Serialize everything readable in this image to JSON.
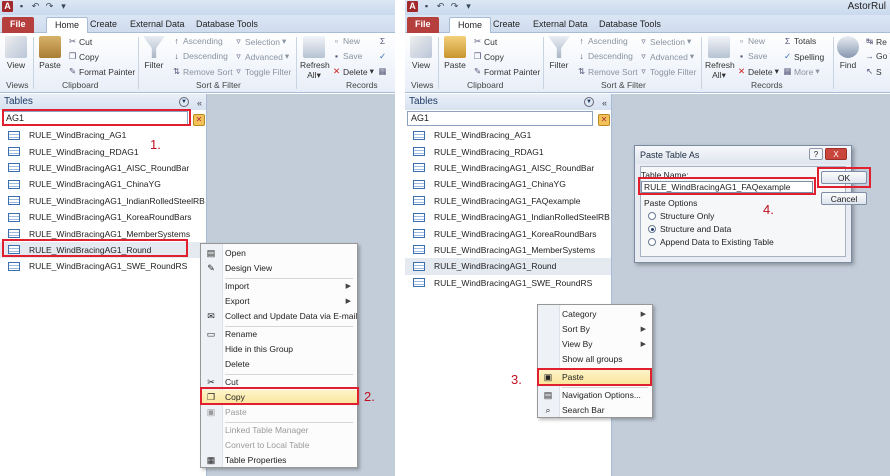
{
  "left": {
    "tabs": {
      "file": "File",
      "home": "Home",
      "create": "Create",
      "external": "External Data",
      "dbtools": "Database Tools"
    },
    "ribbon": {
      "view": "View",
      "paste": "Paste",
      "cut": "Cut",
      "copy": "Copy",
      "format_painter": "Format Painter",
      "filter": "Filter",
      "ascending": "Ascending",
      "descending": "Descending",
      "remove_sort": "Remove Sort",
      "selection": "Selection",
      "advanced": "Advanced",
      "toggle_filter": "Toggle Filter",
      "refresh": "Refresh",
      "refresh2": "All",
      "new": "New",
      "save": "Save",
      "delete": "Delete",
      "views_group": "Views",
      "clipboard_group": "Clipboard",
      "sortfilter_group": "Sort & Filter",
      "records_group": "Records"
    },
    "nav": {
      "title": "Tables",
      "search_value": "AG1",
      "items": [
        "RULE_WindBracing_AG1",
        "RULE_WindBracing_RDAG1",
        "RULE_WindBracingAG1_AISC_RoundBar",
        "RULE_WindBracingAG1_ChinaYG",
        "RULE_WindBracingAG1_IndianRolledSteelRB",
        "RULE_WindBracingAG1_KoreaRoundBars",
        "RULE_WindBracingAG1_MemberSystems",
        "RULE_WindBracingAG1_Round",
        "RULE_WindBracingAG1_SWE_RoundRS"
      ]
    },
    "context_menu": [
      "Open",
      "Design View",
      "Import",
      "Export",
      "Collect and Update Data via E-mail",
      "Rename",
      "Hide in this Group",
      "Delete",
      "Cut",
      "Copy",
      "Paste",
      "Linked Table Manager",
      "Convert to Local Table",
      "Table Properties"
    ],
    "steps": {
      "s1": "1.",
      "s2": "2."
    }
  },
  "right": {
    "window_title": "AstorRul",
    "tabs": {
      "file": "File",
      "home": "Home",
      "create": "Create",
      "external": "External Data",
      "dbtools": "Database Tools"
    },
    "ribbon": {
      "view": "View",
      "paste": "Paste",
      "cut": "Cut",
      "copy": "Copy",
      "format_painter": "Format Painter",
      "filter": "Filter",
      "ascending": "Ascending",
      "descending": "Descending",
      "remove_sort": "Remove Sort",
      "selection": "Selection",
      "advanced": "Advanced",
      "toggle_filter": "Toggle Filter",
      "refresh": "Refresh",
      "refresh2": "All",
      "new": "New",
      "save": "Save",
      "delete": "Delete",
      "totals": "Totals",
      "spelling": "Spelling",
      "more": "More",
      "find": "Find",
      "replace": "Re",
      "goto": "Go T",
      "select": "S",
      "views_group": "Views",
      "clipboard_group": "Clipboard",
      "sortfilter_group": "Sort & Filter",
      "records_group": "Records"
    },
    "nav": {
      "title": "Tables",
      "search_value": "AG1",
      "items": [
        "RULE_WindBracing_AG1",
        "RULE_WindBracing_RDAG1",
        "RULE_WindBracingAG1_AISC_RoundBar",
        "RULE_WindBracingAG1_ChinaYG",
        "RULE_WindBracingAG1_FAQexample",
        "RULE_WindBracingAG1_IndianRolledSteelRB",
        "RULE_WindBracingAG1_KoreaRoundBars",
        "RULE_WindBracingAG1_MemberSystems",
        "RULE_WindBracingAG1_Round",
        "RULE_WindBracingAG1_SWE_RoundRS"
      ]
    },
    "context_menu": [
      "Category",
      "Sort By",
      "View By",
      "Show all groups",
      "Paste",
      "Navigation Options...",
      "Search Bar"
    ],
    "dialog": {
      "title": "Paste Table As",
      "help": "?",
      "close": "X",
      "table_name_label": "Table Name:",
      "table_name_value": "RULE_WindBracingAG1_FAQexample",
      "paste_options_label": "Paste Options",
      "opt1": "Structure Only",
      "opt2": "Structure and Data",
      "opt3": "Append Data to Existing Table",
      "ok": "OK",
      "cancel": "Cancel"
    },
    "steps": {
      "s3": "3.",
      "s4": "4."
    }
  }
}
